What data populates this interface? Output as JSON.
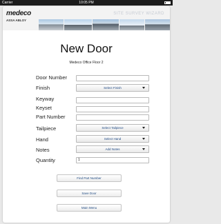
{
  "status_bar": {
    "carrier": "Carrier",
    "time": "10:05 PM"
  },
  "header": {
    "brand": "medeco",
    "sub_brand": "ASSA ABLOY",
    "wizard_title": "SITE SURVEY WIZARD"
  },
  "page": {
    "title": "New Door",
    "subtitle": "Medeco Office Floor 2"
  },
  "form": {
    "door_number": {
      "label": "Door Number",
      "value": ""
    },
    "finish": {
      "label": "Finish",
      "selected": "Select Finish"
    },
    "keyway": {
      "label": "Keyway",
      "value": ""
    },
    "keyset": {
      "label": "Keyset",
      "value": ""
    },
    "part_number": {
      "label": "Part Number",
      "value": ""
    },
    "tailpiece": {
      "label": "Tailpiece",
      "selected": "Select Tailpiece"
    },
    "hand": {
      "label": "Hand",
      "selected": "Select Hand"
    },
    "notes": {
      "label": "Notes",
      "selected": "Add Notes"
    },
    "quantity": {
      "label": "Quantity",
      "value": "1"
    }
  },
  "buttons": {
    "find_part": "Find Part Number",
    "save_door": "Save Door",
    "main_menu": "Main Menu"
  },
  "colors": {
    "link_blue": "#224c86",
    "status_bar": "#1c1c1c",
    "wizard_text": "#c6cbd3"
  }
}
